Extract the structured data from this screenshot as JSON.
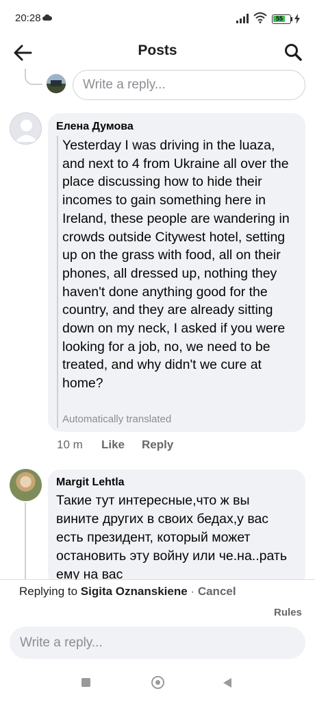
{
  "status_bar": {
    "time": "20:28",
    "battery_level": "55",
    "icons": [
      "cloud-icon",
      "signal-icon",
      "wifi-icon",
      "battery-icon",
      "charging-icon"
    ]
  },
  "header": {
    "title": "Posts",
    "back_icon": "arrow-left-icon",
    "search_icon": "search-icon"
  },
  "top_reply": {
    "placeholder": "Write a reply..."
  },
  "comments": [
    {
      "author": "Елена Думова",
      "text": "Yesterday I was driving in the luaza, and next to 4 from Ukraine all over the place discussing how to hide their incomes to gain something here in Ireland, these people are wandering in crowds outside Citywest hotel, setting up on the grass with food, all on their phones, all dressed up, nothing they haven't done anything good for the country, and they are already sitting down on my neck, I asked if you were looking for a job, no, we need to be treated, and why didn't we cure at home?",
      "translation_note": "Automatically translated",
      "time": "10 m",
      "like_label": "Like",
      "reply_label": "Reply"
    },
    {
      "author": "Margit Lehtla",
      "text": "Такие тут интересные,что ж вы вините других в своих бедах,у вас есть президент, который может остановить эту войну или че.на..рать ему на вас"
    }
  ],
  "composer": {
    "replying_prefix": "Replying to",
    "replying_to": "Sigita Oznanskiene",
    "separator": "·",
    "cancel_label": "Cancel",
    "rules_label": "Rules",
    "placeholder": "Write a reply..."
  },
  "colors": {
    "bubble": "#f0f2f5",
    "secondary_text": "#65676b",
    "battery_green": "#3dbd56"
  }
}
